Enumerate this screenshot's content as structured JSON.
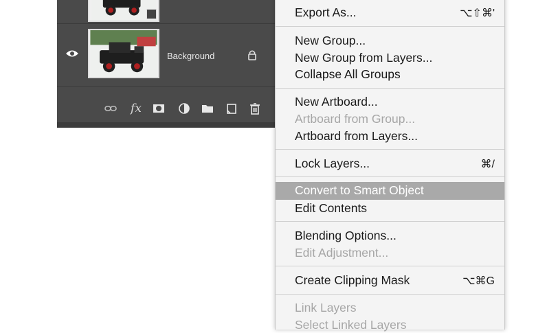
{
  "layers": {
    "background_name": "Background",
    "icons": {
      "visibility": "eye-icon",
      "lock": "lock-icon",
      "toolbar": [
        "link-icon",
        "fx-icon",
        "mask-icon",
        "adjustment-icon",
        "folder-icon",
        "new-layer-icon",
        "trash-icon"
      ]
    },
    "toolbar_fx_label": "fx"
  },
  "menu": {
    "export_as": {
      "label": "Export As...",
      "shortcut": "⌥⇧⌘'"
    },
    "new_group": "New Group...",
    "new_group_from_layers": "New Group from Layers...",
    "collapse_all_groups": "Collapse All Groups",
    "new_artboard": "New Artboard...",
    "artboard_from_group": "Artboard from Group...",
    "artboard_from_layers": "Artboard from Layers...",
    "lock_layers": {
      "label": "Lock Layers...",
      "shortcut": "⌘/"
    },
    "convert_smart_object": "Convert to Smart Object",
    "edit_contents": "Edit Contents",
    "blending_options": "Blending Options...",
    "edit_adjustment": "Edit Adjustment...",
    "create_clipping_mask": {
      "label": "Create Clipping Mask",
      "shortcut": "⌥⌘G"
    },
    "link_layers": "Link Layers",
    "select_linked_layers": "Select Linked Layers"
  }
}
